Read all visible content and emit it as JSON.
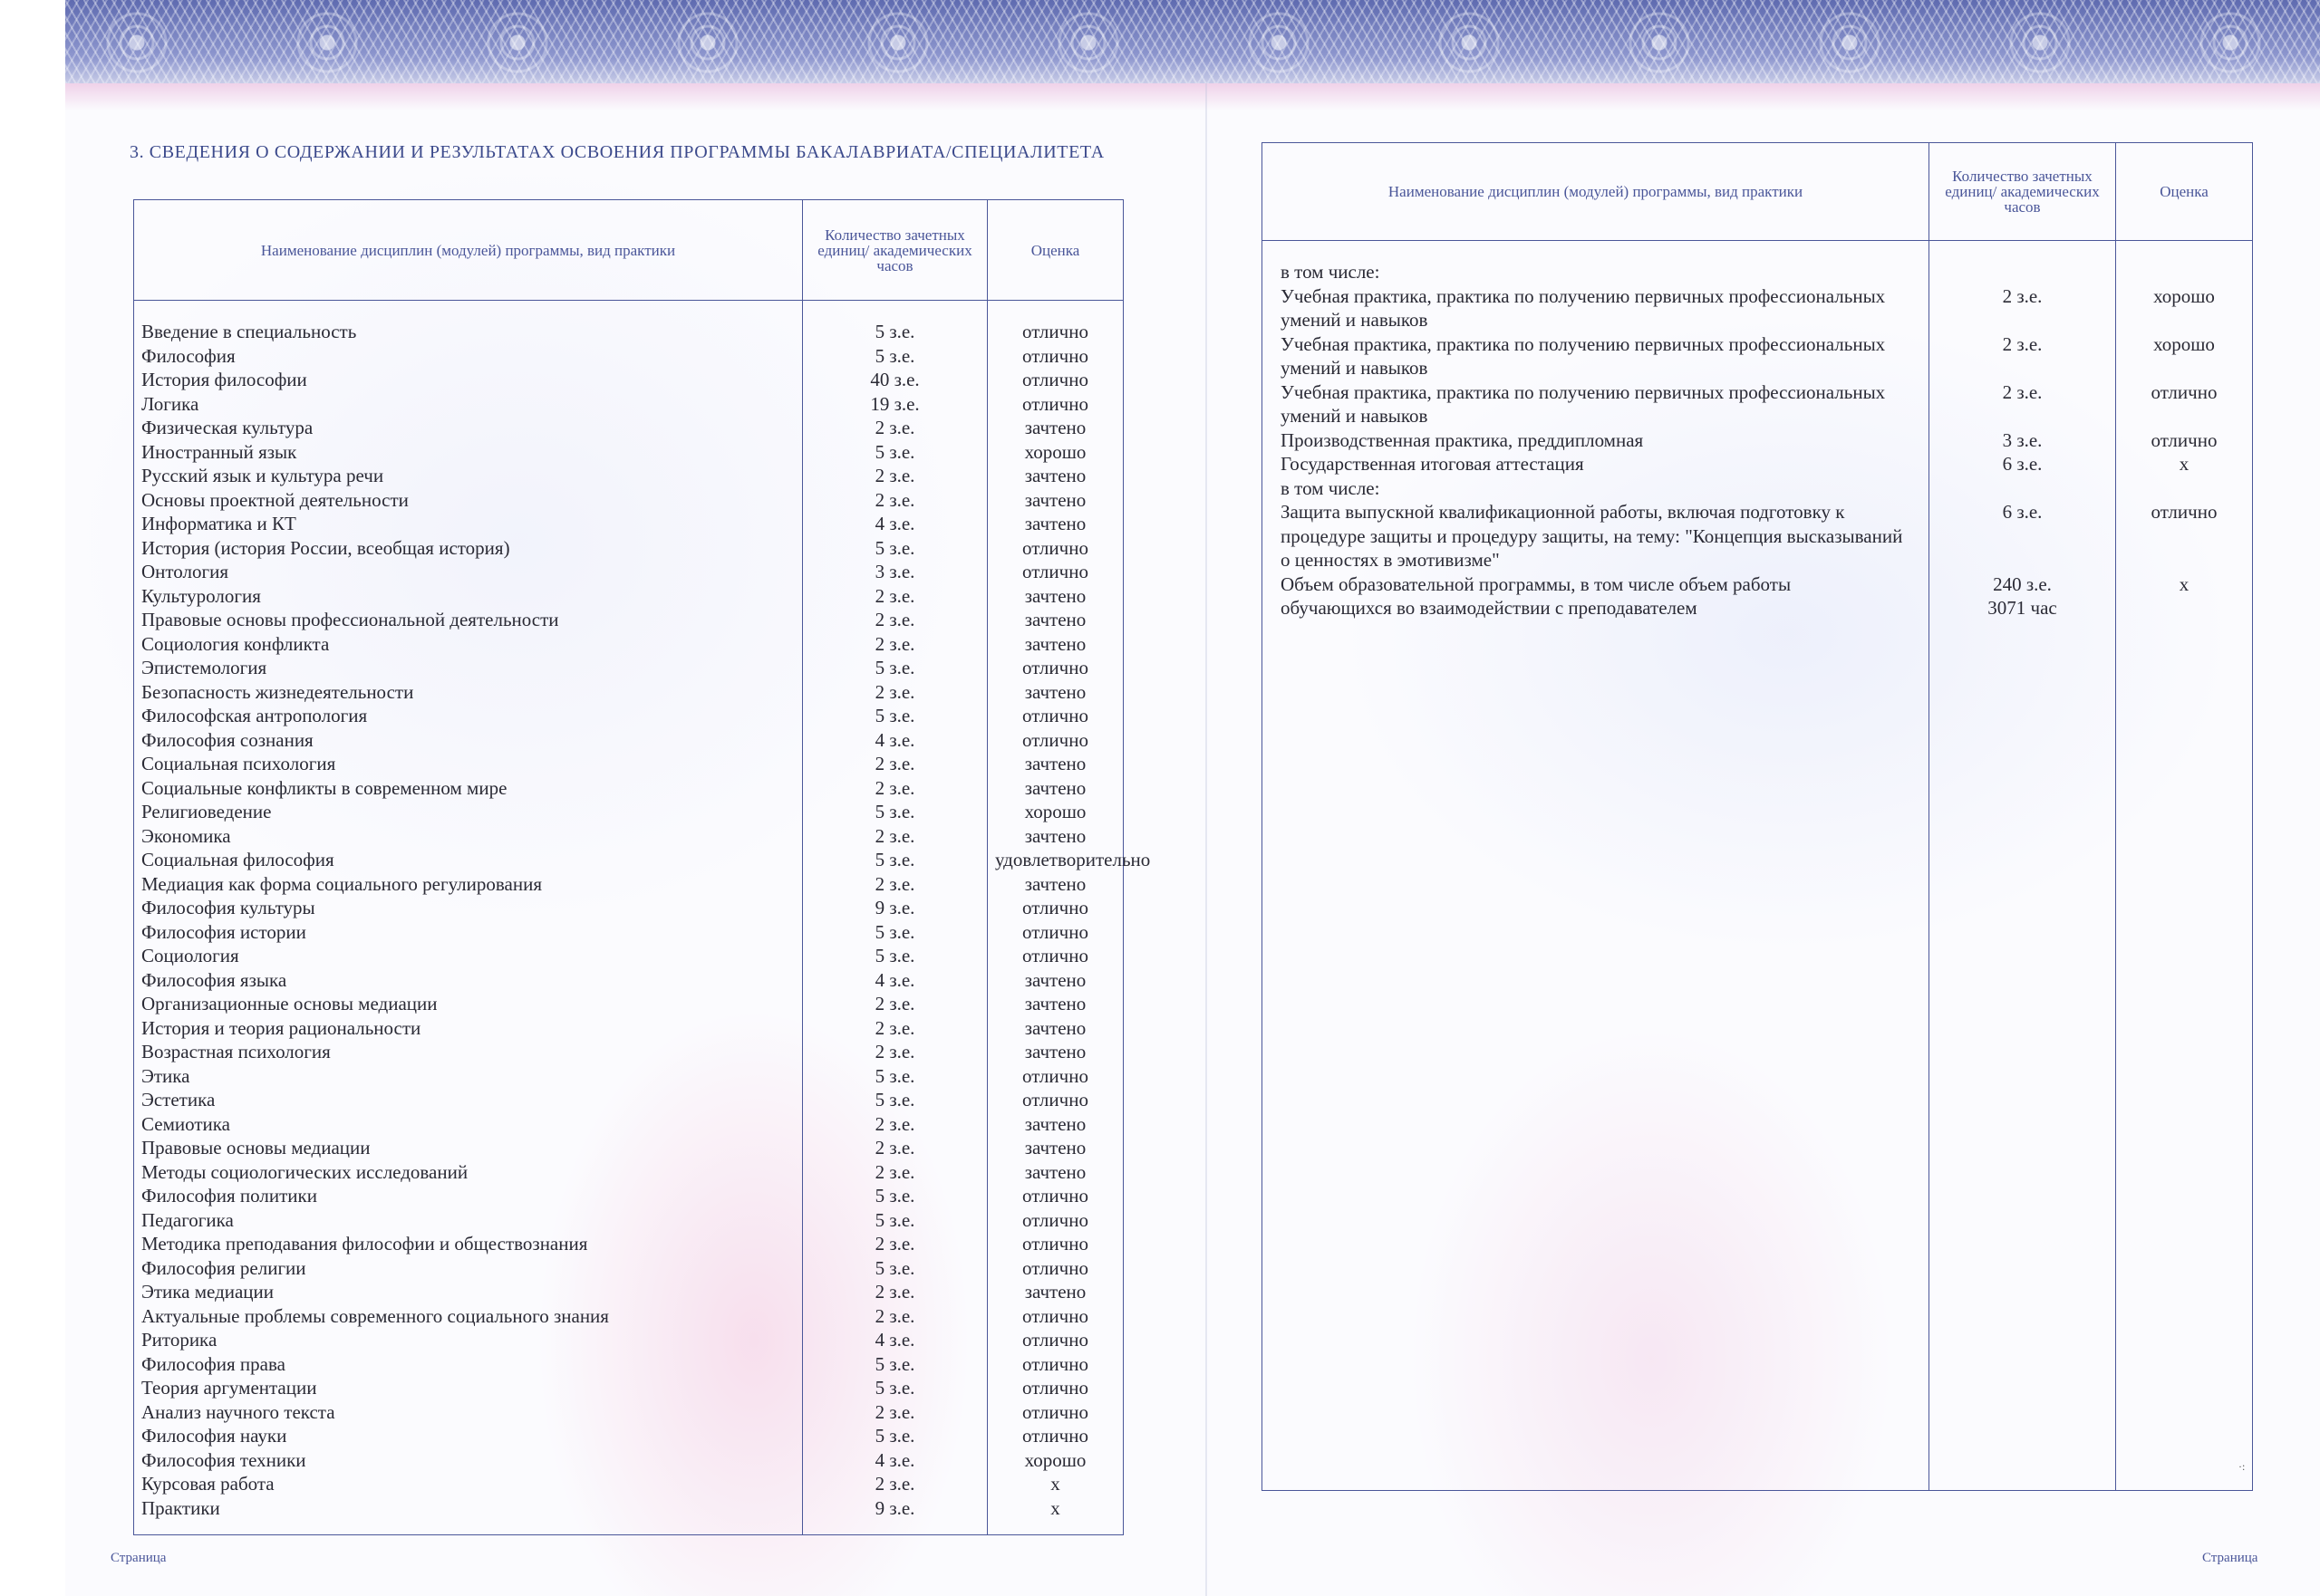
{
  "section_title": "3. СВЕДЕНИЯ О СОДЕРЖАНИИ И РЕЗУЛЬТАТАХ ОСВОЕНИЯ ПРОГРАММЫ БАКАЛАВРИАТА/СПЕЦИАЛИТЕТА",
  "headers": {
    "discipline": "Наименование дисциплин (модулей) программы, вид практики",
    "units": "Количество зачетных единиц/ академических часов",
    "grade": "Оценка"
  },
  "left_rows": [
    {
      "name": "Введение в специальность",
      "units": "5 з.е.",
      "grade": "отлично"
    },
    {
      "name": "Философия",
      "units": "5 з.е.",
      "grade": "отлично"
    },
    {
      "name": "История философии",
      "units": "40 з.е.",
      "grade": "отлично"
    },
    {
      "name": "Логика",
      "units": "19 з.е.",
      "grade": "отлично"
    },
    {
      "name": "Физическая культура",
      "units": "2 з.е.",
      "grade": "зачтено"
    },
    {
      "name": "Иностранный язык",
      "units": "5 з.е.",
      "grade": "хорошо"
    },
    {
      "name": "Русский язык и культура речи",
      "units": "2 з.е.",
      "grade": "зачтено"
    },
    {
      "name": "Основы проектной деятельности",
      "units": "2 з.е.",
      "grade": "зачтено"
    },
    {
      "name": "Информатика и КТ",
      "units": "4 з.е.",
      "grade": "зачтено"
    },
    {
      "name": "История (история России, всеобщая история)",
      "units": "5 з.е.",
      "grade": "отлично"
    },
    {
      "name": "Онтология",
      "units": "3 з.е.",
      "grade": "отлично"
    },
    {
      "name": "Культурология",
      "units": "2 з.е.",
      "grade": "зачтено"
    },
    {
      "name": "Правовые основы профессиональной деятельности",
      "units": "2 з.е.",
      "grade": "зачтено"
    },
    {
      "name": "Социология конфликта",
      "units": "2 з.е.",
      "grade": "зачтено"
    },
    {
      "name": "Эпистемология",
      "units": "5 з.е.",
      "grade": "отлично"
    },
    {
      "name": "Безопасность жизнедеятельности",
      "units": "2 з.е.",
      "grade": "зачтено"
    },
    {
      "name": "Философская антропология",
      "units": "5 з.е.",
      "grade": "отлично"
    },
    {
      "name": "Философия сознания",
      "units": "4 з.е.",
      "grade": "отлично"
    },
    {
      "name": "Социальная психология",
      "units": "2 з.е.",
      "grade": "зачтено"
    },
    {
      "name": "Социальные конфликты в современном мире",
      "units": "2 з.е.",
      "grade": "зачтено"
    },
    {
      "name": "Религиоведение",
      "units": "5 з.е.",
      "grade": "хорошо"
    },
    {
      "name": "Экономика",
      "units": "2 з.е.",
      "grade": "зачтено"
    },
    {
      "name": "Социальная философия",
      "units": "5 з.е.",
      "grade": "удовлетворительно"
    },
    {
      "name": "Медиация как форма социального регулирования",
      "units": "2 з.е.",
      "grade": "зачтено"
    },
    {
      "name": "Философия культуры",
      "units": "9 з.е.",
      "grade": "отлично"
    },
    {
      "name": "Философия истории",
      "units": "5 з.е.",
      "grade": "отлично"
    },
    {
      "name": "Социология",
      "units": "5 з.е.",
      "grade": "отлично"
    },
    {
      "name": "Философия языка",
      "units": "4 з.е.",
      "grade": "зачтено"
    },
    {
      "name": "Организационные основы медиации",
      "units": "2 з.е.",
      "grade": "зачтено"
    },
    {
      "name": "История и теория рациональности",
      "units": "2 з.е.",
      "grade": "зачтено"
    },
    {
      "name": "Возрастная психология",
      "units": "2 з.е.",
      "grade": "зачтено"
    },
    {
      "name": "Этика",
      "units": "5 з.е.",
      "grade": "отлично"
    },
    {
      "name": "Эстетика",
      "units": "5 з.е.",
      "grade": "отлично"
    },
    {
      "name": "Семиотика",
      "units": "2 з.е.",
      "grade": "зачтено"
    },
    {
      "name": "Правовые основы медиации",
      "units": "2 з.е.",
      "grade": "зачтено"
    },
    {
      "name": "Методы социологических исследований",
      "units": "2 з.е.",
      "grade": "зачтено"
    },
    {
      "name": "Философия политики",
      "units": "5 з.е.",
      "grade": "отлично"
    },
    {
      "name": "Педагогика",
      "units": "5 з.е.",
      "grade": "отлично"
    },
    {
      "name": "Методика преподавания философии и обществознания",
      "units": "2 з.е.",
      "grade": "отлично"
    },
    {
      "name": "Философия религии",
      "units": "5 з.е.",
      "grade": "отлично"
    },
    {
      "name": "Этика медиации",
      "units": "2 з.е.",
      "grade": "зачтено"
    },
    {
      "name": "Актуальные проблемы современного социального знания",
      "units": "2 з.е.",
      "grade": "отлично"
    },
    {
      "name": "Риторика",
      "units": "4 з.е.",
      "grade": "отлично"
    },
    {
      "name": "Философия права",
      "units": "5 з.е.",
      "grade": "отлично"
    },
    {
      "name": "Теория аргументации",
      "units": "5 з.е.",
      "grade": "отлично"
    },
    {
      "name": "Анализ научного текста",
      "units": "2 з.е.",
      "grade": "отлично"
    },
    {
      "name": "Философия науки",
      "units": "5 з.е.",
      "grade": "отлично"
    },
    {
      "name": "Философия техники",
      "units": "4 з.е.",
      "grade": "хорошо"
    },
    {
      "name": "Курсовая работа",
      "units": "2 з.е.",
      "grade": "x"
    },
    {
      "name": "Практики",
      "units": "9 з.е.",
      "grade": "x"
    }
  ],
  "right_rows": [
    {
      "name": "в том числе:",
      "units": "",
      "grade": "",
      "indent": false
    },
    {
      "name": "Учебная практика, практика по получению первичных профессиональных умений и навыков",
      "units": "2 з.е.",
      "grade": "хорошо",
      "indent": true
    },
    {
      "name": "Учебная практика, практика по получению первичных профессиональных умений и навыков",
      "units": "2 з.е.",
      "grade": "хорошо",
      "indent": true
    },
    {
      "name": "Учебная практика, практика по получению первичных профессиональных умений и навыков",
      "units": "2 з.е.",
      "grade": "отлично",
      "indent": true
    },
    {
      "name": "Производственная практика, преддипломная",
      "units": "3 з.е.",
      "grade": "отлично",
      "indent": true
    },
    {
      "name": "Государственная итоговая аттестация",
      "units": "6 з.е.",
      "grade": "x",
      "indent": true
    },
    {
      "name": "в том числе:",
      "units": "",
      "grade": "",
      "indent": false
    },
    {
      "name": "Защита выпускной квалификационной работы, включая подготовку к процедуре защиты и процедуру защиты, на тему: \"Концепция высказываний о ценностях в эмотивизме\"",
      "units": "6 з.е.",
      "grade": "отлично",
      "indent": true
    },
    {
      "name": "Объем образовательной программы, в том числе объем работы обучающихся во взаимодействии с преподавателем",
      "units": "240 з.е.",
      "units2": "3071 час",
      "grade": "x",
      "indent": true
    }
  ],
  "footer_left": "Страница",
  "footer_right": "Страница"
}
